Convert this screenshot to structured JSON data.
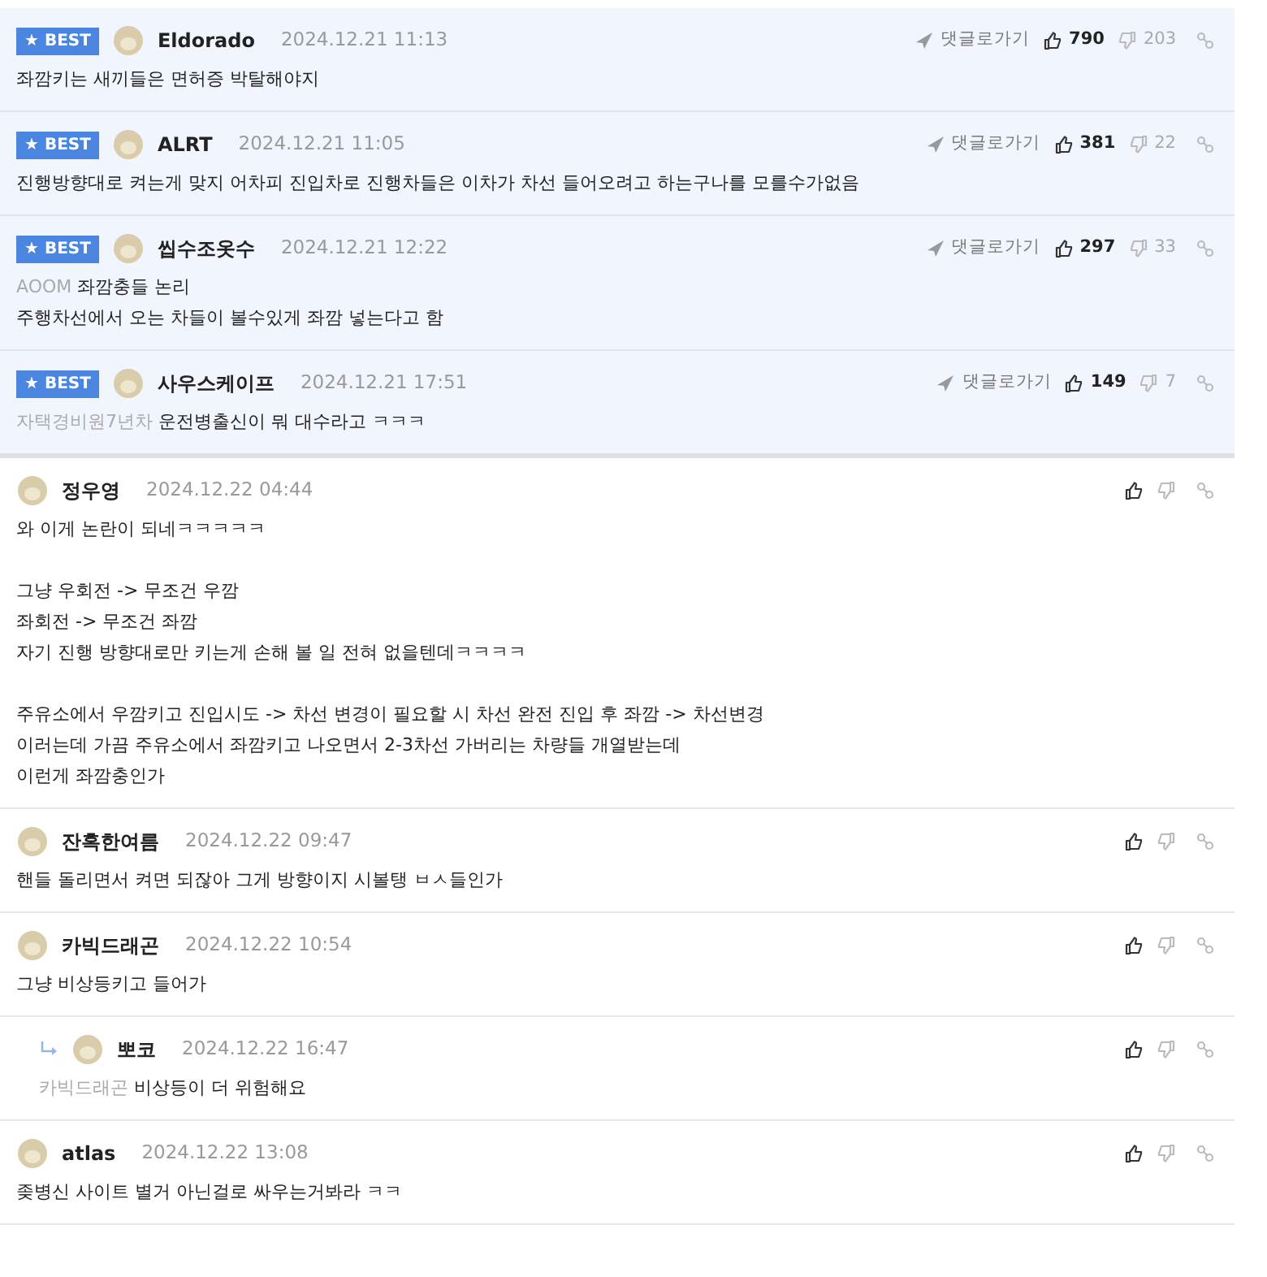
{
  "comments": [
    {
      "best": true,
      "badge": "★ BEST",
      "author": "Eldorado",
      "time": "2024.12.21 11:13",
      "goto": "댓글로가기",
      "likes": "790",
      "dislikes": "203",
      "is_reply": false,
      "body": "좌깜키는 새끼들은 면허증 박탈해야지"
    },
    {
      "best": true,
      "badge": "★ BEST",
      "author": "ALRT",
      "time": "2024.12.21 11:05",
      "goto": "댓글로가기",
      "likes": "381",
      "dislikes": "22",
      "is_reply": false,
      "body": "진행방향대로 켜는게 맞지 어차피 진입차로 진행차들은 이차가 차선 들어오려고 하는구나를 모를수가없음"
    },
    {
      "best": true,
      "badge": "★ BEST",
      "author": "씹수조옷수",
      "time": "2024.12.21 12:22",
      "goto": "댓글로가기",
      "likes": "297",
      "dislikes": "33",
      "is_reply": false,
      "mention": "AOOM",
      "body": "좌깜충들 논리\n주행차선에서 오는 차들이 볼수있게 좌깜 넣는다고 함"
    },
    {
      "best": true,
      "badge": "★ BEST",
      "author": "사우스케이프",
      "time": "2024.12.21 17:51",
      "goto": "댓글로가기",
      "likes": "149",
      "dislikes": "7",
      "is_reply": false,
      "mention": "자택경비원7년차",
      "body": "운전병출신이 뭐 대수라고 ㅋㅋㅋ"
    },
    {
      "best": false,
      "author": "정우영",
      "time": "2024.12.22 04:44",
      "is_reply": false,
      "body": "와 이게 논란이 되네ㅋㅋㅋㅋㅋ\n\n그냥 우회전 -> 무조건 우깜\n좌회전 -> 무조건 좌깜\n자기 진행 방향대로만 키는게 손해 볼 일 전혀 없을텐데ㅋㅋㅋㅋ\n\n주유소에서 우깜키고 진입시도 -> 차선 변경이 필요할 시 차선 완전 진입 후 좌깜 -> 차선변경\n이러는데 가끔 주유소에서 좌깜키고 나오면서 2-3차선 가버리는 차량들 개열받는데\n이런게 좌깜충인가"
    },
    {
      "best": false,
      "author": "잔혹한여름",
      "time": "2024.12.22 09:47",
      "is_reply": false,
      "body": "핸들 돌리면서 켜면 되잖아 그게 방향이지 시볼탱 ㅂㅅ들인가"
    },
    {
      "best": false,
      "author": "카빅드래곤",
      "time": "2024.12.22 10:54",
      "is_reply": false,
      "body": "그냥 비상등키고 들어가"
    },
    {
      "best": false,
      "author": "뽀코",
      "time": "2024.12.22 16:47",
      "is_reply": true,
      "mention": "카빅드래곤",
      "body": "비상등이 더 위험해요"
    },
    {
      "best": false,
      "author": "atlas",
      "time": "2024.12.22 13:08",
      "is_reply": false,
      "body": "좆병신 사이트 별거 아닌걸로 싸우는거봐라 ㅋㅋ"
    }
  ]
}
